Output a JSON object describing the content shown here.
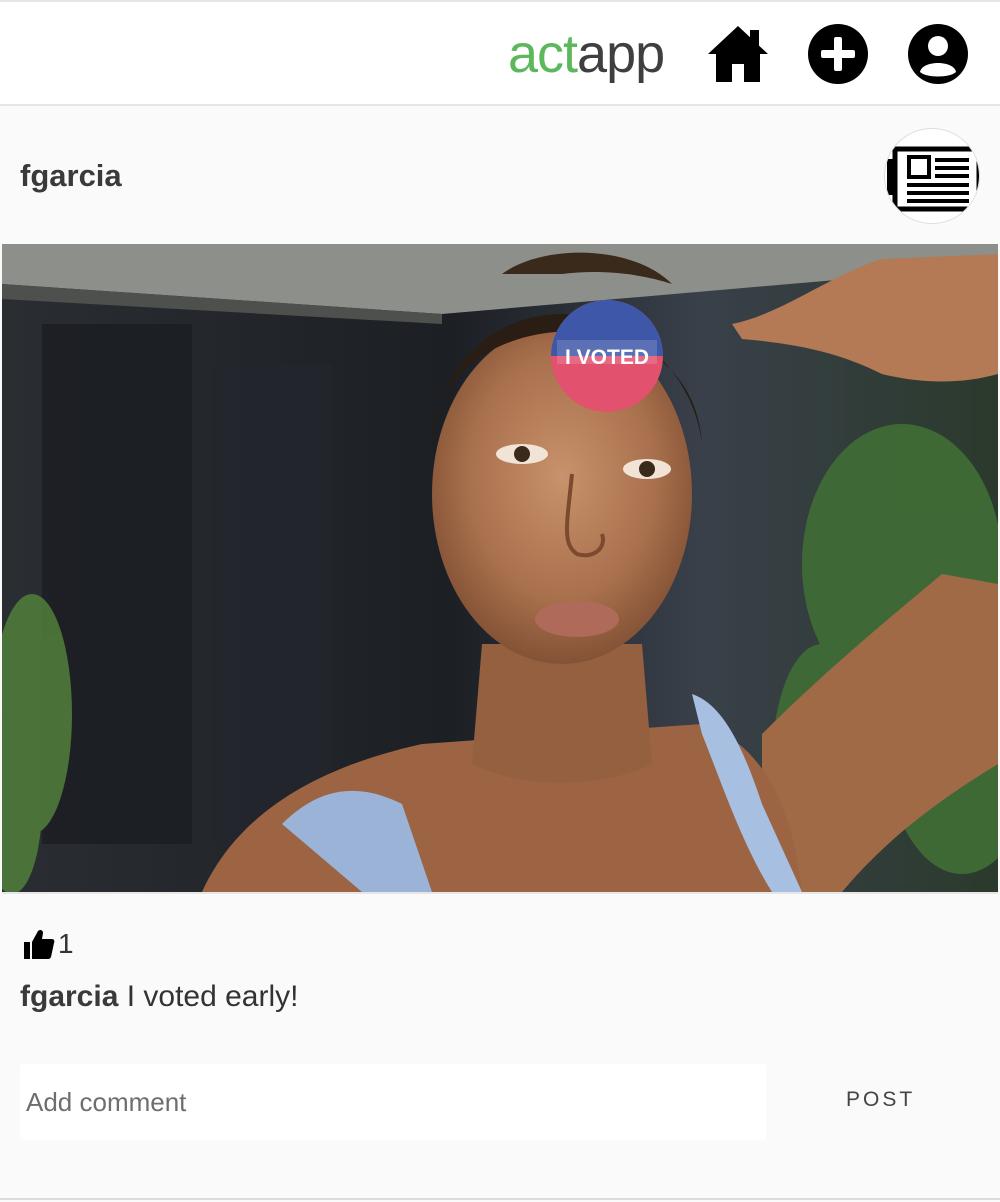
{
  "header": {
    "logo_part1": "act",
    "logo_part2": "app",
    "nav_icons": [
      "home-icon",
      "add-circle-icon",
      "user-circle-icon"
    ]
  },
  "post": {
    "username": "fgarcia",
    "avatar_icon": "newspaper-icon",
    "photo_sticker_text": "I VOTED",
    "likes": "1",
    "caption_user": "fgarcia",
    "caption_text": " I voted early!",
    "comment_placeholder": "Add comment",
    "post_label": "POST"
  },
  "colors": {
    "brand_green": "#5cb85c",
    "brand_dark": "#3f3f3f",
    "background": "#fafafa"
  }
}
